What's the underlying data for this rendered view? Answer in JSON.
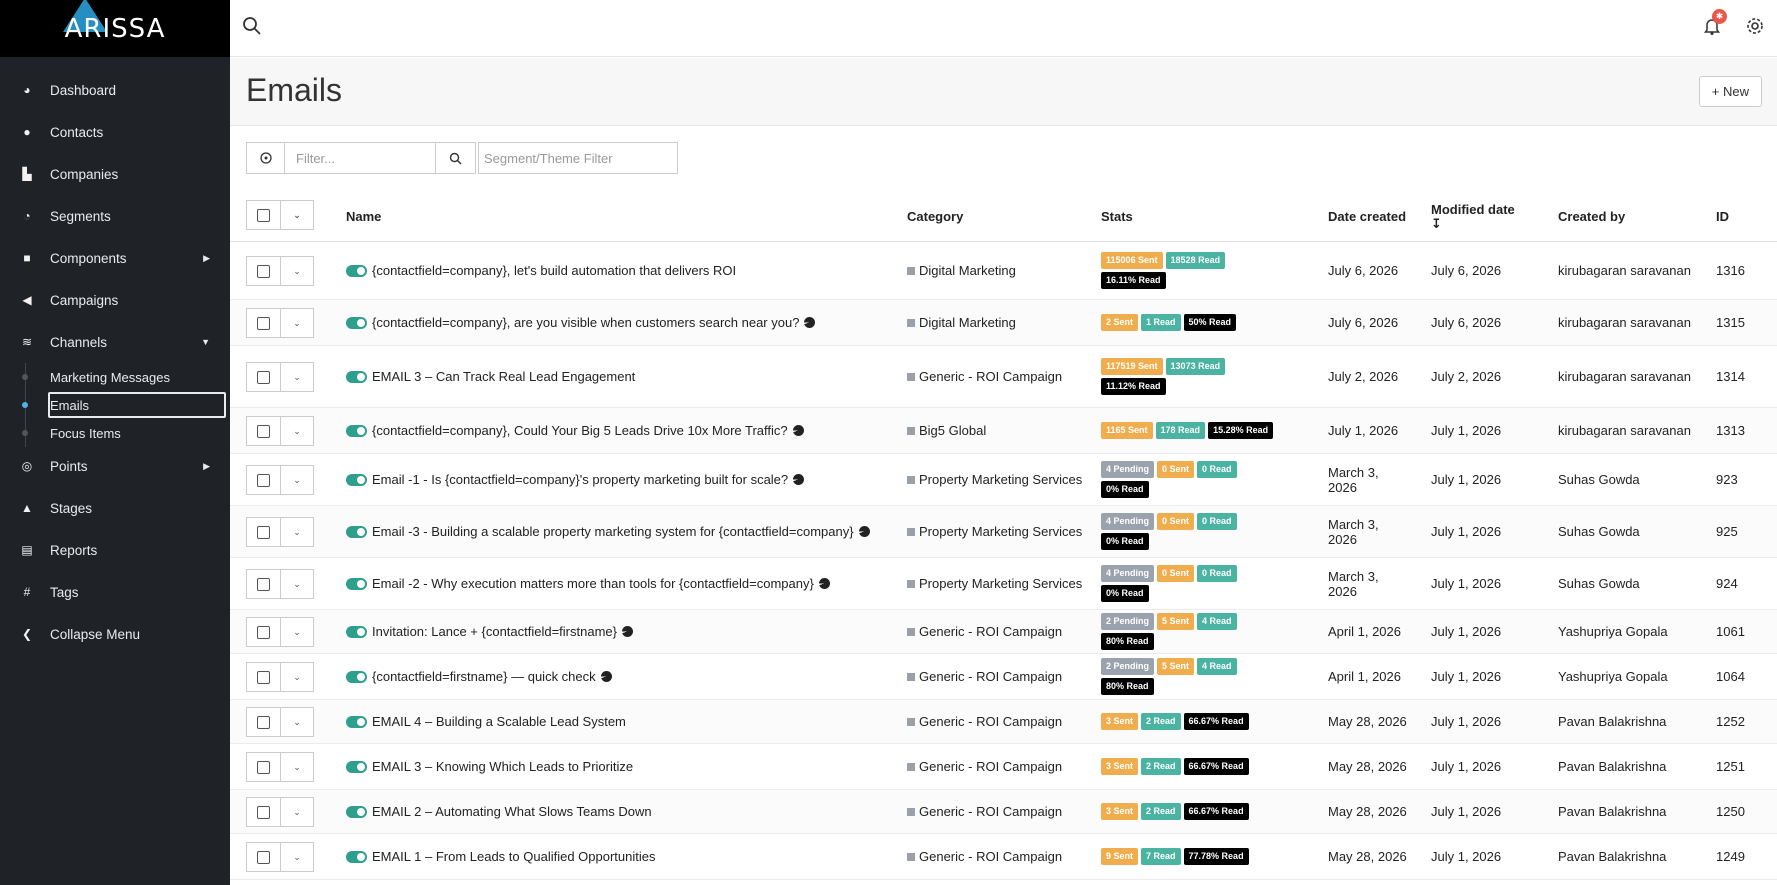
{
  "app": {
    "logo": "ARISSA"
  },
  "sidebar": {
    "items": [
      {
        "label": "Dashboard",
        "icon": "dashboard-icon",
        "glyph": "◕"
      },
      {
        "label": "Contacts",
        "icon": "user-icon",
        "glyph": "●"
      },
      {
        "label": "Companies",
        "icon": "building-icon",
        "glyph": "▙"
      },
      {
        "label": "Segments",
        "icon": "pie-chart-icon",
        "glyph": "◔"
      },
      {
        "label": "Components",
        "icon": "puzzle-icon",
        "glyph": "■"
      },
      {
        "label": "Campaigns",
        "icon": "megaphone-icon",
        "glyph": "◀"
      },
      {
        "label": "Channels",
        "icon": "rss-icon",
        "glyph": "≋"
      }
    ],
    "channels_sub": [
      "Marketing Messages",
      "Emails",
      "Focus Items"
    ],
    "items_after": [
      {
        "label": "Points",
        "icon": "target-icon",
        "glyph": "◎"
      },
      {
        "label": "Stages",
        "icon": "stages-icon",
        "glyph": "▲"
      },
      {
        "label": "Reports",
        "icon": "report-icon",
        "glyph": "▤"
      },
      {
        "label": "Tags",
        "icon": "hash-icon",
        "glyph": "#"
      },
      {
        "label": "Collapse Menu",
        "icon": "chevron-left-icon",
        "glyph": "❮"
      }
    ]
  },
  "topbar": {
    "notification_count": "✱"
  },
  "page": {
    "title": "Emails",
    "new_button": "+ New"
  },
  "filters": {
    "filter_placeholder": "Filter...",
    "segment_placeholder": "Segment/Theme Filter"
  },
  "table": {
    "headers": {
      "name": "Name",
      "category": "Category",
      "stats": "Stats",
      "date_created": "Date created",
      "modified_date": "Modified date",
      "created_by": "Created by",
      "id": "ID"
    },
    "rows": [
      {
        "name": "{contactfield=company}, let's build automation that delivers ROI",
        "pie": false,
        "category": "Digital Marketing",
        "stats": [
          {
            "t": "115006 Sent",
            "k": "sent"
          },
          {
            "t": "18528 Read",
            "k": "read"
          },
          {
            "t": "16.11% Read",
            "k": "pct"
          }
        ],
        "created": "July 6, 2026",
        "modified": "July 6, 2026",
        "by": "kirubagaran saravanan",
        "id": "1316"
      },
      {
        "name": "{contactfield=company}, are you visible when customers search near you?",
        "pie": true,
        "category": "Digital Marketing",
        "stats": [
          {
            "t": "2 Sent",
            "k": "sent"
          },
          {
            "t": "1 Read",
            "k": "read"
          },
          {
            "t": "50% Read",
            "k": "pct"
          }
        ],
        "created": "July 6, 2026",
        "modified": "July 6, 2026",
        "by": "kirubagaran saravanan",
        "id": "1315"
      },
      {
        "name": "EMAIL 3 – Can Track Real Lead Engagement",
        "pie": false,
        "category": "Generic - ROI Campaign",
        "stats": [
          {
            "t": "117519 Sent",
            "k": "sent"
          },
          {
            "t": "13073 Read",
            "k": "read"
          },
          {
            "t": "11.12% Read",
            "k": "pct"
          }
        ],
        "created": "July 2, 2026",
        "modified": "July 2, 2026",
        "by": "kirubagaran saravanan",
        "id": "1314"
      },
      {
        "name": "{contactfield=company}, Could Your Big 5 Leads Drive 10x More Traffic?",
        "pie": true,
        "category": "Big5 Global",
        "stats": [
          {
            "t": "1165 Sent",
            "k": "sent"
          },
          {
            "t": "178 Read",
            "k": "read"
          },
          {
            "t": "15.28% Read",
            "k": "pct"
          }
        ],
        "created": "July 1, 2026",
        "modified": "July 1, 2026",
        "by": "kirubagaran saravanan",
        "id": "1313"
      },
      {
        "name": "Email -1 - Is {contactfield=company}'s property marketing built for scale?",
        "pie": true,
        "category": "Property Marketing Services",
        "stats": [
          {
            "t": "4 Pending",
            "k": "pend"
          },
          {
            "t": "0 Sent",
            "k": "sent"
          },
          {
            "t": "0 Read",
            "k": "read"
          },
          {
            "t": "0% Read",
            "k": "pct"
          }
        ],
        "created": "March 3, 2026",
        "modified": "July 1, 2026",
        "by": "Suhas Gowda",
        "id": "923"
      },
      {
        "name": "Email -3 - Building a scalable property marketing system for {contactfield=company}",
        "pie": true,
        "category": "Property Marketing Services",
        "stats": [
          {
            "t": "4 Pending",
            "k": "pend"
          },
          {
            "t": "0 Sent",
            "k": "sent"
          },
          {
            "t": "0 Read",
            "k": "read"
          },
          {
            "t": "0% Read",
            "k": "pct"
          }
        ],
        "created": "March 3, 2026",
        "modified": "July 1, 2026",
        "by": "Suhas Gowda",
        "id": "925"
      },
      {
        "name": "Email -2 - Why execution matters more than tools for {contactfield=company}",
        "pie": true,
        "category": "Property Marketing Services",
        "stats": [
          {
            "t": "4 Pending",
            "k": "pend"
          },
          {
            "t": "0 Sent",
            "k": "sent"
          },
          {
            "t": "0 Read",
            "k": "read"
          },
          {
            "t": "0% Read",
            "k": "pct"
          }
        ],
        "created": "March 3, 2026",
        "modified": "July 1, 2026",
        "by": "Suhas Gowda",
        "id": "924"
      },
      {
        "name": "Invitation: Lance + {contactfield=firstname}",
        "pie": true,
        "category": "Generic - ROI Campaign",
        "stats": [
          {
            "t": "2 Pending",
            "k": "pend"
          },
          {
            "t": "5 Sent",
            "k": "sent"
          },
          {
            "t": "4 Read",
            "k": "read"
          },
          {
            "t": "80% Read",
            "k": "pct"
          }
        ],
        "created": "April 1, 2026",
        "modified": "July 1, 2026",
        "by": "Yashupriya Gopala",
        "id": "1061"
      },
      {
        "name": "{contactfield=firstname} — quick check",
        "pie": true,
        "category": "Generic - ROI Campaign",
        "stats": [
          {
            "t": "2 Pending",
            "k": "pend"
          },
          {
            "t": "5 Sent",
            "k": "sent"
          },
          {
            "t": "4 Read",
            "k": "read"
          },
          {
            "t": "80% Read",
            "k": "pct"
          }
        ],
        "created": "April 1, 2026",
        "modified": "July 1, 2026",
        "by": "Yashupriya Gopala",
        "id": "1064"
      },
      {
        "name": "EMAIL 4 – Building a Scalable Lead System",
        "pie": false,
        "category": "Generic - ROI Campaign",
        "stats": [
          {
            "t": "3 Sent",
            "k": "sent"
          },
          {
            "t": "2 Read",
            "k": "read"
          },
          {
            "t": "66.67% Read",
            "k": "pct"
          }
        ],
        "created": "May 28, 2026",
        "modified": "July 1, 2026",
        "by": "Pavan Balakrishna",
        "id": "1252"
      },
      {
        "name": "EMAIL 3 – Knowing Which Leads to Prioritize",
        "pie": false,
        "category": "Generic - ROI Campaign",
        "stats": [
          {
            "t": "3 Sent",
            "k": "sent"
          },
          {
            "t": "2 Read",
            "k": "read"
          },
          {
            "t": "66.67% Read",
            "k": "pct"
          }
        ],
        "created": "May 28, 2026",
        "modified": "July 1, 2026",
        "by": "Pavan Balakrishna",
        "id": "1251"
      },
      {
        "name": "EMAIL 2 – Automating What Slows Teams Down",
        "pie": false,
        "category": "Generic - ROI Campaign",
        "stats": [
          {
            "t": "3 Sent",
            "k": "sent"
          },
          {
            "t": "2 Read",
            "k": "read"
          },
          {
            "t": "66.67% Read",
            "k": "pct"
          }
        ],
        "created": "May 28, 2026",
        "modified": "July 1, 2026",
        "by": "Pavan Balakrishna",
        "id": "1250"
      },
      {
        "name": "EMAIL 1 – From Leads to Qualified Opportunities",
        "pie": false,
        "category": "Generic - ROI Campaign",
        "stats": [
          {
            "t": "9 Sent",
            "k": "sent"
          },
          {
            "t": "7 Read",
            "k": "read"
          },
          {
            "t": "77.78% Read",
            "k": "pct"
          }
        ],
        "created": "May 28, 2026",
        "modified": "July 1, 2026",
        "by": "Pavan Balakrishna",
        "id": "1249"
      }
    ]
  },
  "colors": {
    "sidebar_bg": "#1f2227",
    "sent": "#f0ad4e",
    "read": "#4ab3a2",
    "pct": "#000000",
    "pending": "#9aa3ad",
    "toggle_on": "#2e9e8d"
  }
}
